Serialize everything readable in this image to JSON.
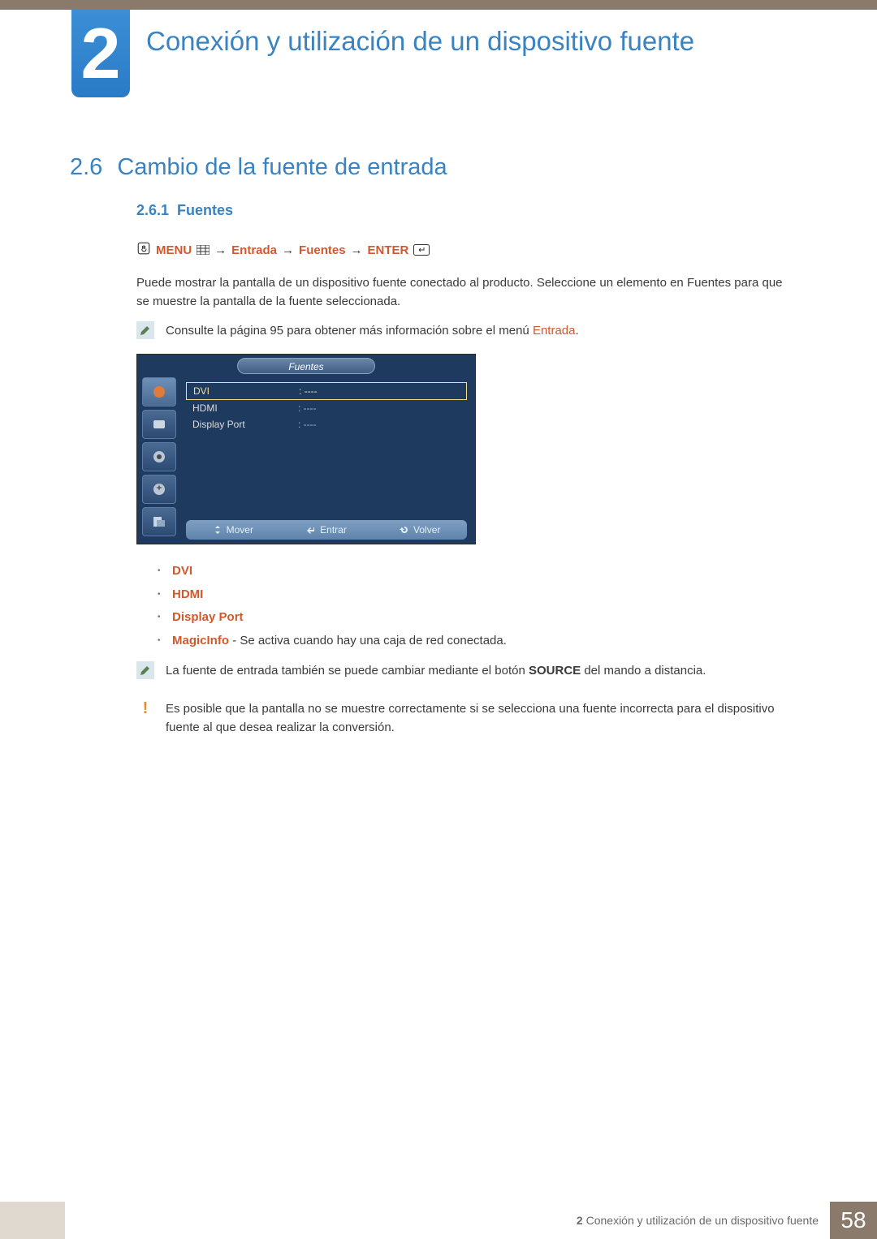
{
  "chapter": {
    "number": "2",
    "title": "Conexión y utilización de un dispositivo fuente"
  },
  "section": {
    "number": "2.6",
    "title": "Cambio de la fuente de entrada"
  },
  "subsection": {
    "number": "2.6.1",
    "title": "Fuentes"
  },
  "nav_path": {
    "menu": "MENU",
    "step1": "Entrada",
    "step2": "Fuentes",
    "enter": "ENTER",
    "arrow": "→"
  },
  "paragraphs": {
    "intro": "Puede mostrar la pantalla de un dispositivo fuente conectado al producto. Seleccione un elemento en Fuentes para que se muestre la pantalla de la fuente seleccionada."
  },
  "notes": {
    "ref_prefix": "Consulte la página 95 para obtener más información sobre el menú ",
    "ref_link": "Entrada",
    "ref_suffix": ".",
    "source_prefix": "La fuente de entrada también se puede cambiar mediante el botón ",
    "source_bold": "SOURCE",
    "source_suffix": " del mando a distancia.",
    "warning": "Es posible que la pantalla no se muestre correctamente si se selecciona una fuente incorrecta para el dispositivo fuente al que desea realizar la conversión."
  },
  "osd": {
    "title": "Fuentes",
    "rows": [
      {
        "label": "DVI",
        "value": ": ----",
        "selected": true
      },
      {
        "label": "HDMI",
        "value": ": ----",
        "selected": false
      },
      {
        "label": "Display Port",
        "value": ": ----",
        "selected": false
      }
    ],
    "footer": {
      "move": "Mover",
      "enter": "Entrar",
      "back": "Volver"
    }
  },
  "bullets": {
    "items": [
      {
        "label": "DVI",
        "extra": ""
      },
      {
        "label": "HDMI",
        "extra": ""
      },
      {
        "label": "Display Port",
        "extra": ""
      },
      {
        "label": "MagicInfo",
        "extra": " - Se activa cuando hay una caja de red conectada."
      }
    ]
  },
  "footer": {
    "label_num": "2",
    "label_text": "Conexión y utilización de un dispositivo fuente",
    "page": "58"
  }
}
